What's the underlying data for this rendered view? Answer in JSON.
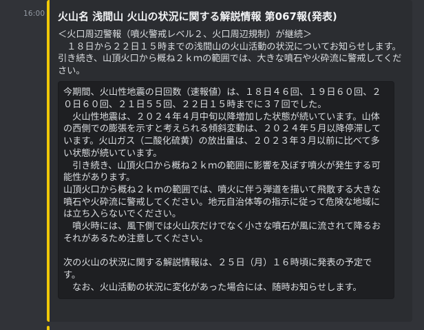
{
  "message": {
    "timestamp": "16:00",
    "accent_color": "#f0c808",
    "embed": {
      "title": "火山名 浅間山 火山の状況に関する解説情報 第067報(発表)",
      "description": "＜火口周辺警報（噴火警戒レベル２、火口周辺規制）が継続＞\n　１８日から２２日１５時までの浅間山の火山活動の状況についてお知らせします。引き続き、山頂火口から概ね２ｋｍの範囲では、大きな噴石や火砕流に警戒してください。",
      "code_block": "今期間、火山性地震の日回数（速報値）は、１８日４６回、１９日６０回、２０日６０回、２１日５５回、２２日１５時までに３７回でした。\n　火山性地震は、２０２４年４月中旬以降増加した状態が続いています。山体の西側での膨張を示すと考えられる傾斜変動は、２０２４年５月以降停滞しています。火山ガス（二酸化硫黄）の放出量は、２０２３年３月以前に比べて多い状態が続いています。\n　引き続き、山頂火口から概ね２ｋｍの範囲に影響を及ぼす噴火が発生する可能性があります。\n山頂火口から概ね２ｋｍの範囲では、噴火に伴う弾道を描いて飛散する大きな噴石や火砕流に警戒してください。地元自治体等の指示に従って危険な地域には立ち入らないでください。\n　噴火時には、風下側では火山灰だけでなく小さな噴石が風に流されて降るおそれがあるため注意してください。\n\n次の火山の状況に関する解説情報は、２５日（月）１６時頃に発表の予定です。\n　なお、火山活動の状況に変化があった場合には、随時お知らせします。"
    }
  }
}
